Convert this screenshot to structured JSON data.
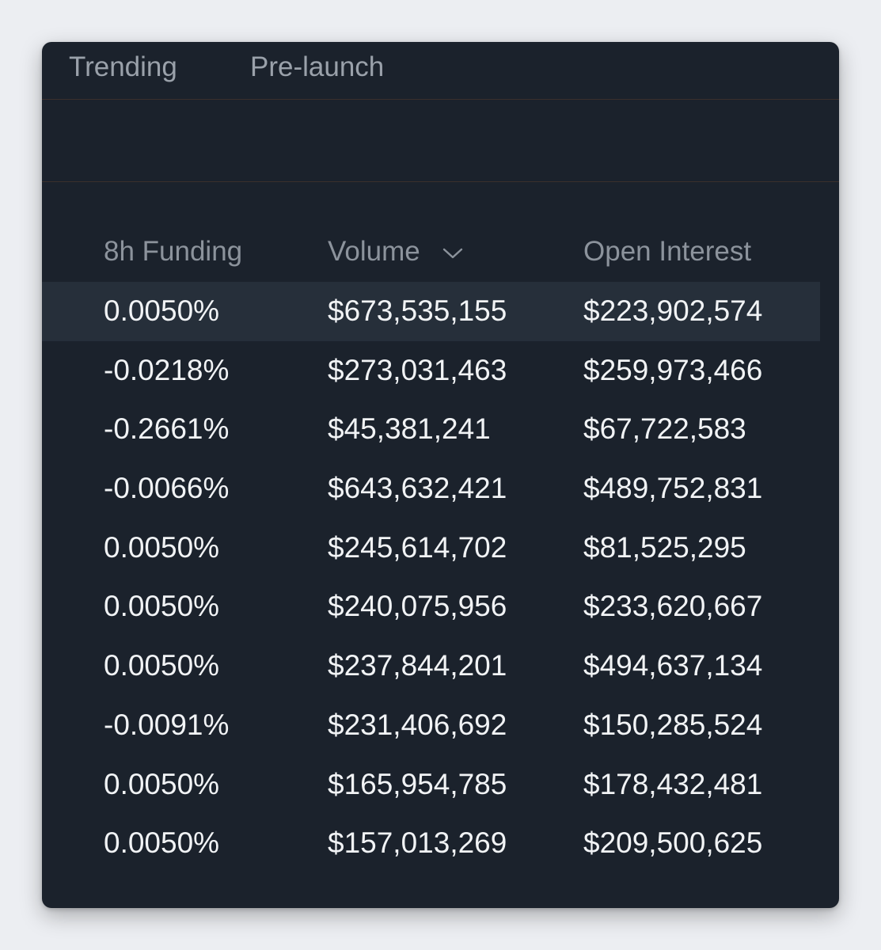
{
  "tabs": [
    {
      "label": "Trending"
    },
    {
      "label": "Pre-launch"
    }
  ],
  "table": {
    "columns": [
      {
        "label": "8h Funding"
      },
      {
        "label": "Volume",
        "sort_icon": "chevron-down-icon"
      },
      {
        "label": "Open Interest"
      }
    ],
    "rows": [
      {
        "funding": "0.0050%",
        "volume": "$673,535,155",
        "open_interest": "$223,902,574"
      },
      {
        "funding": "-0.0218%",
        "volume": "$273,031,463",
        "open_interest": "$259,973,466"
      },
      {
        "funding": "-0.2661%",
        "volume": "$45,381,241",
        "open_interest": "$67,722,583"
      },
      {
        "funding": "-0.0066%",
        "volume": "$643,632,421",
        "open_interest": "$489,752,831"
      },
      {
        "funding": "0.0050%",
        "volume": "$245,614,702",
        "open_interest": "$81,525,295"
      },
      {
        "funding": "0.0050%",
        "volume": "$240,075,956",
        "open_interest": "$233,620,667"
      },
      {
        "funding": "0.0050%",
        "volume": "$237,844,201",
        "open_interest": "$494,637,134"
      },
      {
        "funding": "-0.0091%",
        "volume": "$231,406,692",
        "open_interest": "$150,285,524"
      },
      {
        "funding": "0.0050%",
        "volume": "$165,954,785",
        "open_interest": "$178,432,481"
      },
      {
        "funding": "0.0050%",
        "volume": "$157,013,269",
        "open_interest": "$209,500,625"
      }
    ]
  },
  "colors": {
    "panel_bg": "#1b222c",
    "highlight_row_bg": "#262f3a",
    "divider": "#3b2f2c",
    "text_primary": "#f1f3f5",
    "text_muted": "#8c939c"
  }
}
